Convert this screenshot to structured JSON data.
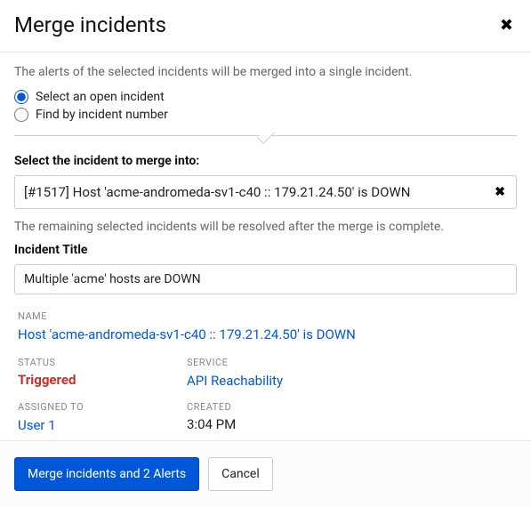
{
  "modal": {
    "title": "Merge incidents",
    "help_text": "The alerts of the selected incidents will be merged into a single incident.",
    "radio": {
      "open": "Select an open incident",
      "find": "Find by incident number"
    },
    "select_label": "Select the incident to merge into:",
    "selected_incident": "[#1517] Host 'acme-andromeda-sv1-c40 :: 179.21.24.50' is DOWN",
    "remaining_text": "The remaining selected incidents will be resolved after the merge is complete.",
    "title_label": "Incident Title",
    "title_value": "Multiple 'acme' hosts are DOWN"
  },
  "details": {
    "name_label": "NAME",
    "name_value": "Host 'acme-andromeda-sv1-c40 :: 179.21.24.50' is DOWN",
    "status_label": "STATUS",
    "status_value": "Triggered",
    "service_label": "SERVICE",
    "service_value": "API Reachability",
    "assigned_label": "ASSIGNED TO",
    "assigned_value": "User 1",
    "created_label": "CREATED",
    "created_value": "3:04 PM"
  },
  "footer": {
    "merge": "Merge incidents and 2 Alerts",
    "cancel": "Cancel"
  }
}
